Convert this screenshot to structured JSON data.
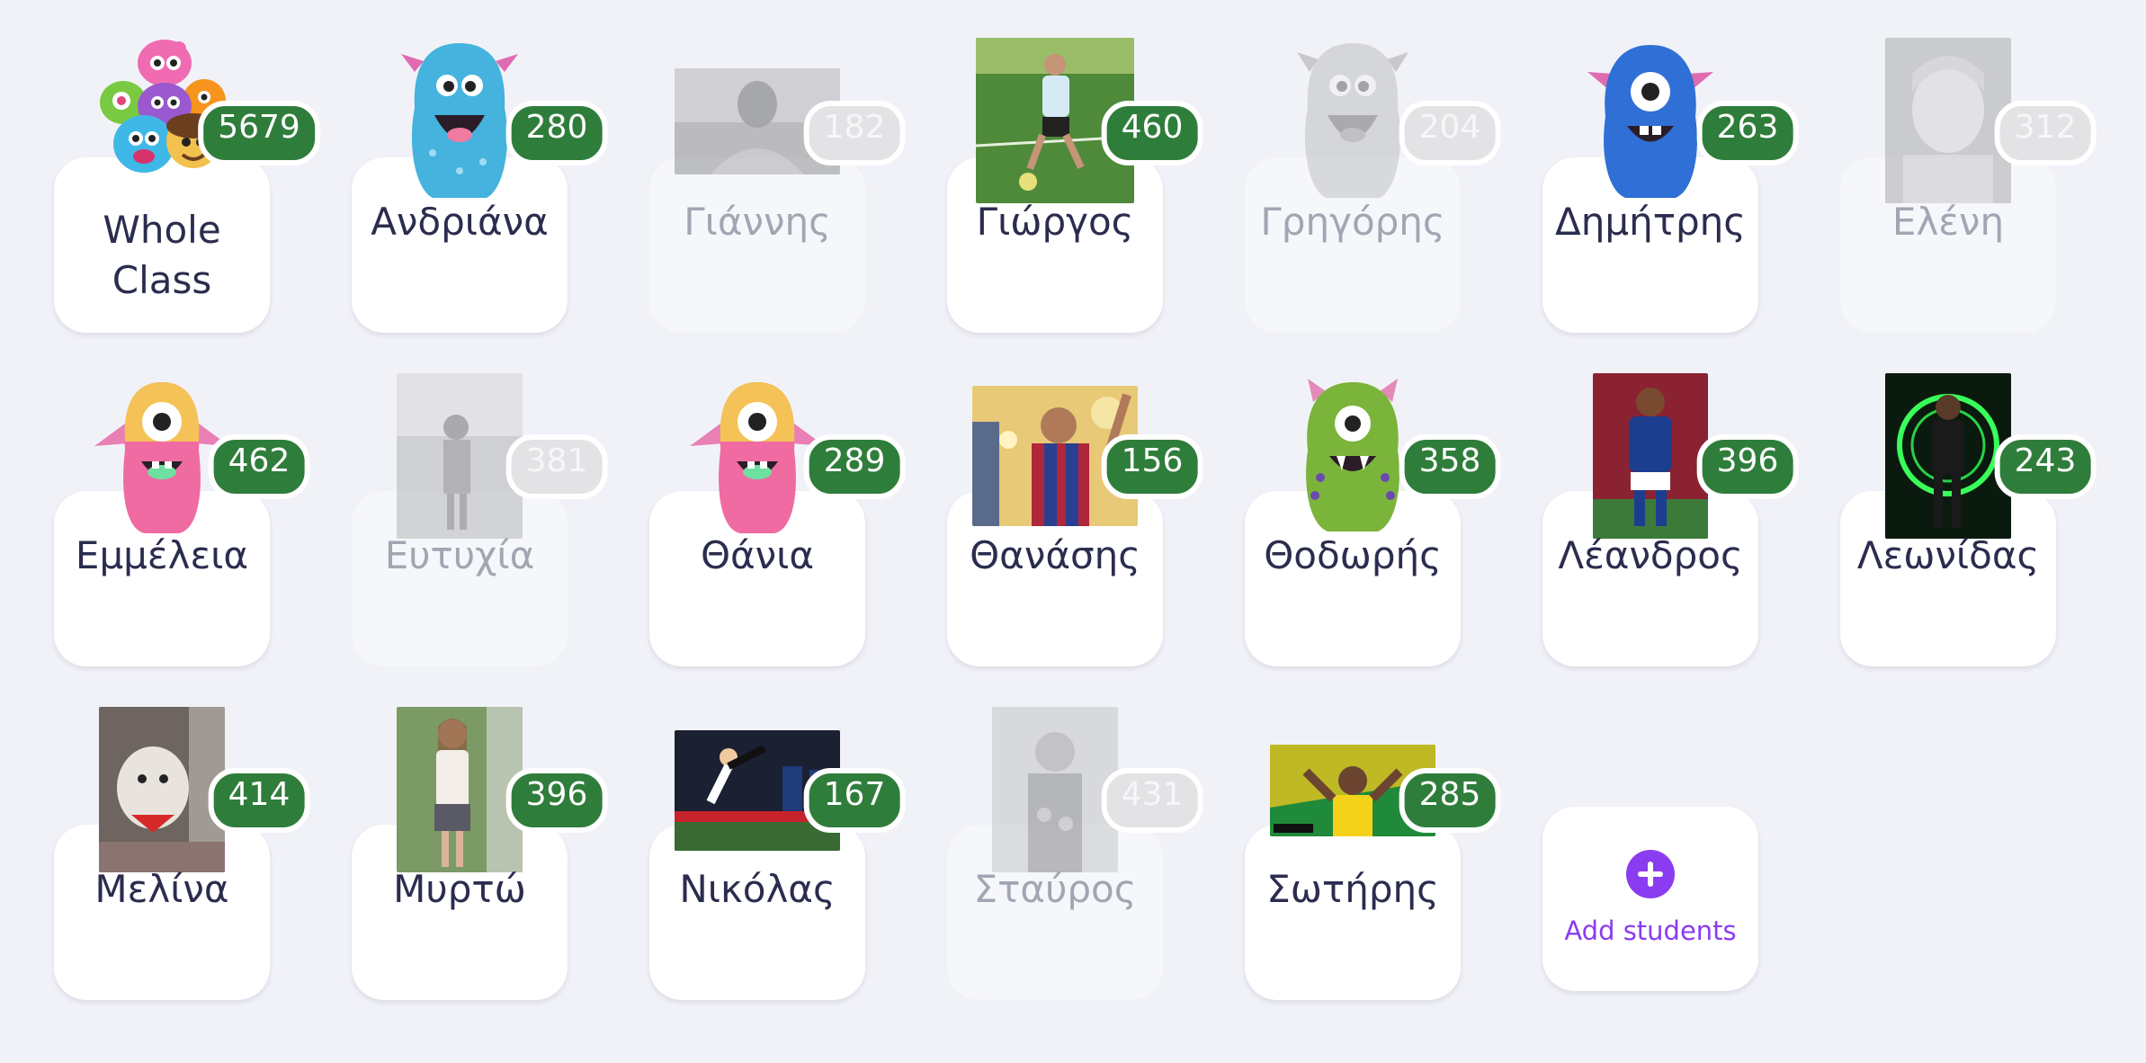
{
  "whole_class": {
    "name": "Whole Class",
    "points": "5679"
  },
  "students": [
    {
      "name": "Ανδριάνα",
      "points": "280",
      "avatar": "monster-blue-icon",
      "absent": false
    },
    {
      "name": "Γιάννης",
      "points": "182",
      "avatar": "photo",
      "absent": true
    },
    {
      "name": "Γιώργος",
      "points": "460",
      "avatar": "photo",
      "absent": false
    },
    {
      "name": "Γρηγόρης",
      "points": "204",
      "avatar": "monster-grey-icon",
      "absent": true
    },
    {
      "name": "Δημήτρης",
      "points": "263",
      "avatar": "monster-cyclops-blue-icon",
      "absent": false
    },
    {
      "name": "Ελένη",
      "points": "312",
      "avatar": "photo",
      "absent": true
    },
    {
      "name": "Εμμέλεια",
      "points": "462",
      "avatar": "monster-cyclops-pink-icon",
      "absent": false
    },
    {
      "name": "Ευτυχία",
      "points": "381",
      "avatar": "photo",
      "absent": true
    },
    {
      "name": "Θάνια",
      "points": "289",
      "avatar": "monster-cyclops-pink-icon",
      "absent": false
    },
    {
      "name": "Θανάσης",
      "points": "156",
      "avatar": "photo",
      "absent": false
    },
    {
      "name": "Θοδωρής",
      "points": "358",
      "avatar": "monster-cyclops-green-icon",
      "absent": false
    },
    {
      "name": "Λέανδρος",
      "points": "396",
      "avatar": "photo",
      "absent": false
    },
    {
      "name": "Λεωνίδας",
      "points": "243",
      "avatar": "photo",
      "absent": false
    },
    {
      "name": "Μελίνα",
      "points": "414",
      "avatar": "photo",
      "absent": false
    },
    {
      "name": "Μυρτώ",
      "points": "396",
      "avatar": "photo",
      "absent": false
    },
    {
      "name": "Νικόλας",
      "points": "167",
      "avatar": "photo",
      "absent": false
    },
    {
      "name": "Σταύρος",
      "points": "431",
      "avatar": "photo",
      "absent": true
    },
    {
      "name": "Σωτήρης",
      "points": "285",
      "avatar": "photo",
      "absent": false
    }
  ],
  "add_students": {
    "label": "Add students",
    "icon": "plus-circle-icon"
  },
  "colors": {
    "background": "#f1f2f8",
    "card": "#ffffff",
    "badge_green": "#2f7d3b",
    "badge_absent": "#e3e3e6",
    "name_text": "#2b2d4f",
    "name_absent": "#a4a5b2",
    "accent_purple": "#8a3cf0"
  }
}
